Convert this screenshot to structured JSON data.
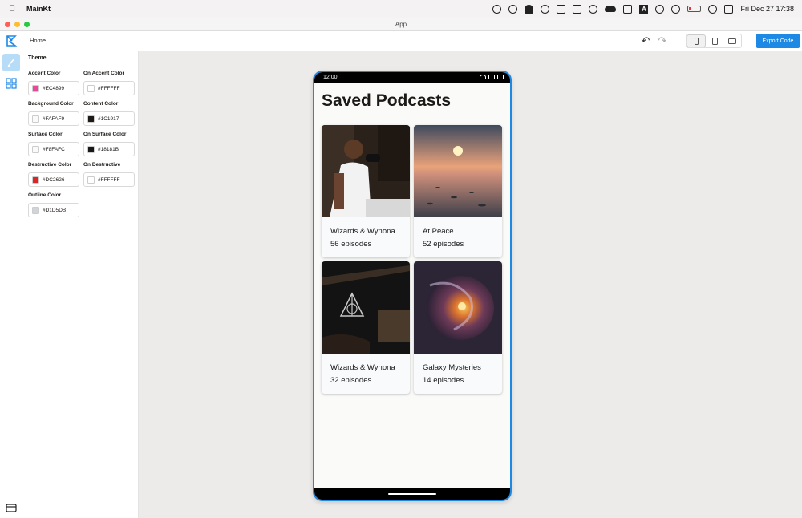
{
  "menubar": {
    "app_name": "MainKt",
    "clock": "Fri Dec 27  17:38"
  },
  "window": {
    "title": "App"
  },
  "toolbar": {
    "breadcrumb": "Home",
    "export_label": "Export Code"
  },
  "theme_panel": {
    "title": "Theme",
    "fields": [
      {
        "label": "Accent Color",
        "value": "#EC4899",
        "swatch": "#EC4899"
      },
      {
        "label": "On Accent Color",
        "value": "#FFFFFF",
        "swatch": "#FFFFFF"
      },
      {
        "label": "Background Color",
        "value": "#FAFAF9",
        "swatch": "#FAFAF9"
      },
      {
        "label": "Content Color",
        "value": "#1C1917",
        "swatch": "#1C1917"
      },
      {
        "label": "Surface Color",
        "value": "#F8FAFC",
        "swatch": "#F8FAFC"
      },
      {
        "label": "On Surface Color",
        "value": "#18181B",
        "swatch": "#18181B"
      },
      {
        "label": "Destructive Color",
        "value": "#DC2626",
        "swatch": "#DC2626"
      },
      {
        "label": "On Destructive",
        "value": "#FFFFFF",
        "swatch": "#FFFFFF"
      },
      {
        "label": "Outline Color",
        "value": "#D1D5DB",
        "swatch": "#D1D5DB"
      }
    ]
  },
  "phone": {
    "status_time": "12:00",
    "screen_title": "Saved Podcasts",
    "podcasts": [
      {
        "name": "Wizards & Wynona",
        "episodes": "56 episodes"
      },
      {
        "name": "At Peace",
        "episodes": "52 episodes"
      },
      {
        "name": "Wizards & Wynona",
        "episodes": "32 episodes"
      },
      {
        "name": "Galaxy Mysteries",
        "episodes": "14 episodes"
      }
    ]
  }
}
